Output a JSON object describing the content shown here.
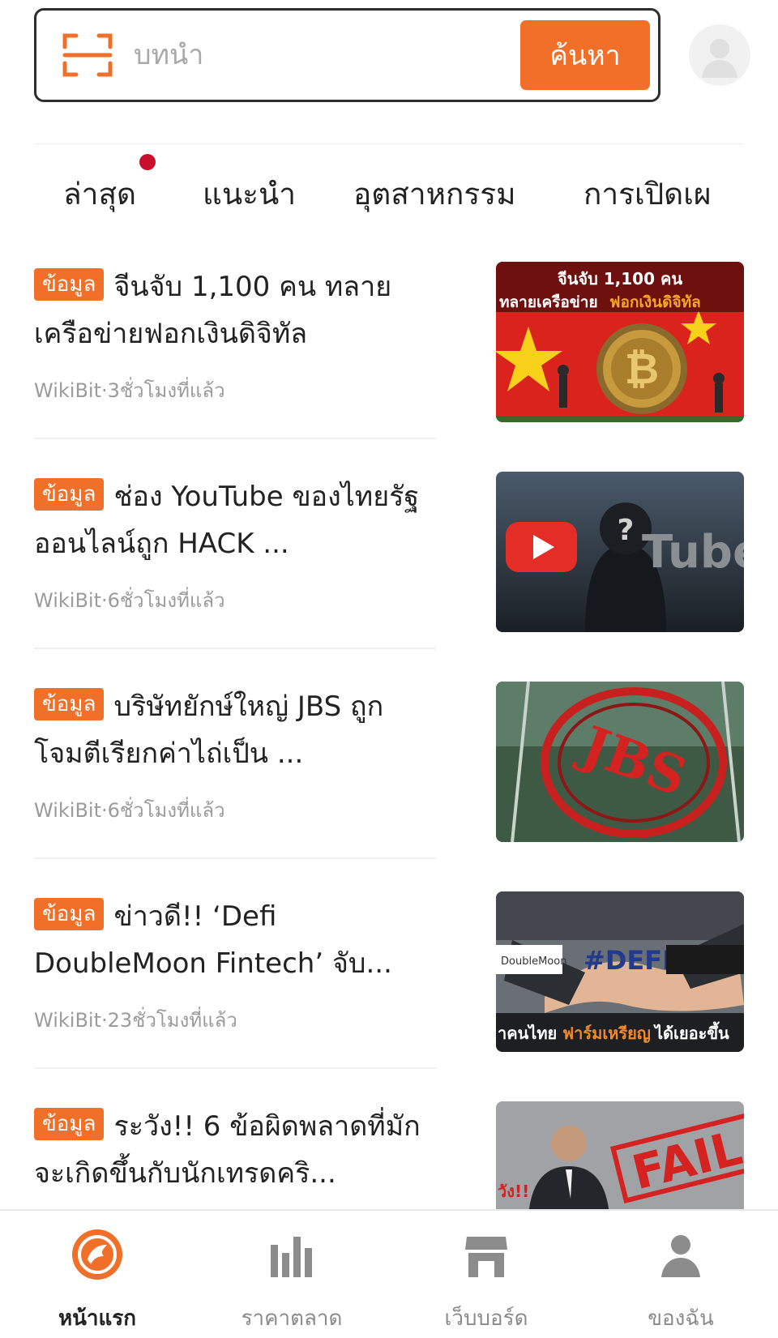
{
  "search": {
    "placeholder": "บทนำ",
    "button_label": "ค้นหา",
    "scan_icon": "scan-frame-icon",
    "accent_color": "#f0702a"
  },
  "tabs": [
    {
      "label": "ล่าสุด",
      "has_notification_dot": true
    },
    {
      "label": "แนะนำ",
      "active": true
    },
    {
      "label": "อุตสาหกรรม"
    },
    {
      "label": "การเปิดเผ"
    }
  ],
  "articles": [
    {
      "badge": "ข้อมูล",
      "title": "จีนจับ 1,100 คน ทลายเครือข่ายฟอกเงินดิจิทัล",
      "meta": "WikiBit·3ชั่วโมงที่แล้ว",
      "thumb_text_1": "จีนจับ 1,100 คน",
      "thumb_text_2": "ทลายเครือข่าย",
      "thumb_text_3": "ฟอกเงินดิจิทัล"
    },
    {
      "badge": "ข้อมูล",
      "title": "ช่อง YouTube ของไทยรัฐออนไลน์ถูก HACK ...",
      "meta": "WikiBit·6ชั่วโมงที่แล้ว",
      "thumb_text_1": "Tube"
    },
    {
      "badge": "ข้อมูล",
      "title": "บริษัทยักษ์ใหญ่ JBS ถูกโจมตีเรียกค่าไถ่เป็น ...",
      "meta": "WikiBit·6ชั่วโมงที่แล้ว",
      "thumb_text_1": "JBS"
    },
    {
      "badge": "ข้อมูล",
      "title": "ข่าวดี!! ‘Defi DoubleMoon Fintech’ จับ...",
      "meta": "WikiBit·23ชั่วโมงที่แล้ว",
      "thumb_text_1": "#DEFI",
      "thumb_text_2": "DoubleMoon",
      "thumb_text_3": "าคนไทย",
      "thumb_text_4": "ฟาร์มเหรียญ",
      "thumb_text_5": "ได้เยอะขึ้น"
    },
    {
      "badge": "ข้อมูล",
      "title": "ระวัง!! 6 ข้อผิดพลาดที่มักจะเกิดขึ้นกับนักเทรดคริ...",
      "meta": "",
      "thumb_text_1": "FAIL",
      "thumb_text_2": "วัง!!"
    }
  ],
  "bottom_nav": [
    {
      "label": "หน้าแรก",
      "icon": "home-logo-icon",
      "active": true
    },
    {
      "label": "ราคาตลาด",
      "icon": "bar-chart-icon"
    },
    {
      "label": "เว็บบอร์ด",
      "icon": "store-icon"
    },
    {
      "label": "ของฉัน",
      "icon": "person-icon"
    }
  ]
}
